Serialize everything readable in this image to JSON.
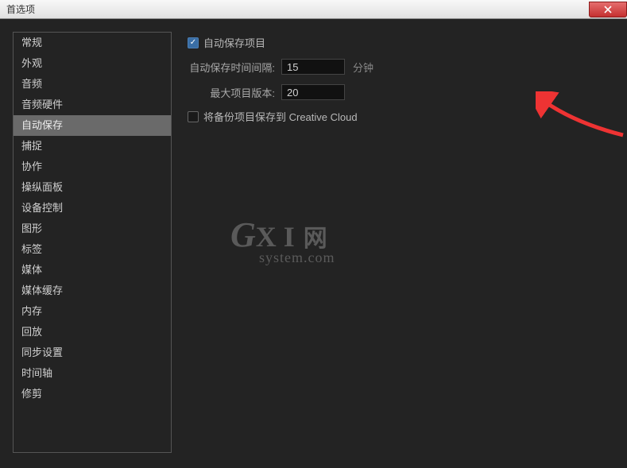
{
  "titlebar": {
    "title": "首选项"
  },
  "sidebar": {
    "items": [
      {
        "label": "常规"
      },
      {
        "label": "外观"
      },
      {
        "label": "音频"
      },
      {
        "label": "音频硬件"
      },
      {
        "label": "自动保存",
        "selected": true
      },
      {
        "label": "捕捉"
      },
      {
        "label": "协作"
      },
      {
        "label": "操纵面板"
      },
      {
        "label": "设备控制"
      },
      {
        "label": "图形"
      },
      {
        "label": "标签"
      },
      {
        "label": "媒体"
      },
      {
        "label": "媒体缓存"
      },
      {
        "label": "内存"
      },
      {
        "label": "回放"
      },
      {
        "label": "同步设置"
      },
      {
        "label": "时间轴"
      },
      {
        "label": "修剪"
      }
    ]
  },
  "content": {
    "autosave_checkbox": {
      "label": "自动保存项目",
      "checked": true
    },
    "interval": {
      "label": "自动保存时间间隔:",
      "value": "15",
      "unit": "分钟"
    },
    "max_versions": {
      "label": "最大项目版本:",
      "value": "20"
    },
    "backup_cloud": {
      "label": "将备份项目保存到 Creative Cloud",
      "checked": false
    }
  },
  "watermark": {
    "line1_a": "G",
    "line1_b": "X I",
    "line1_c": "网",
    "line2": "system.com"
  }
}
